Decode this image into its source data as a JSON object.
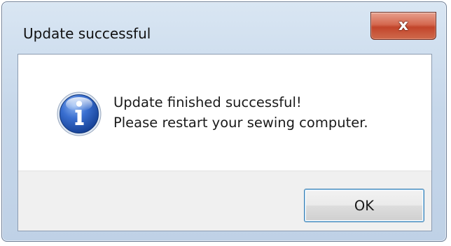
{
  "dialog": {
    "title": "Update successful",
    "close_label": "x",
    "icon": "info-icon",
    "message_lines": [
      "Update finished successful!",
      "Please restart your sewing computer."
    ],
    "ok_label": "OK"
  },
  "colors": {
    "frame": "#c6d7ea",
    "close_button": "#c2452b",
    "footer": "#f0f0f0",
    "ok_border": "#3c7fb1",
    "icon_blue": "#2a5bb8"
  }
}
